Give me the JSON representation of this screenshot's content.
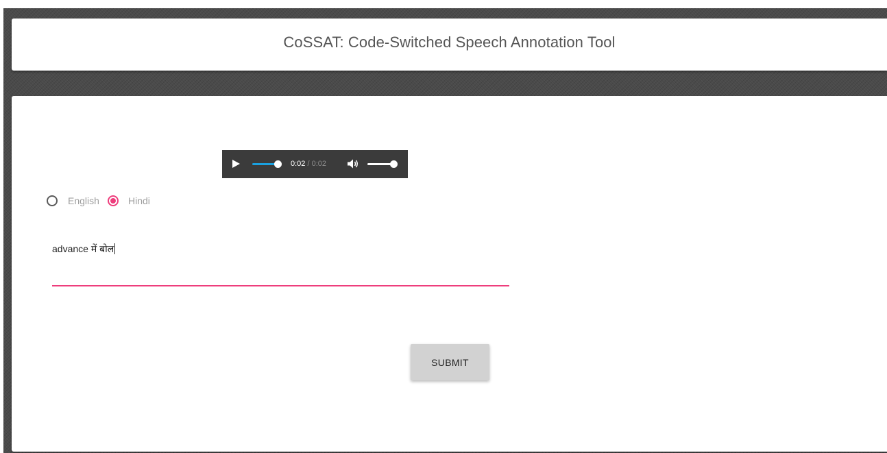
{
  "header": {
    "title": "CoSSAT: Code-Switched Speech Annotation Tool"
  },
  "audio_player": {
    "current_time": "0:02",
    "separator": " / ",
    "duration": "0:02",
    "playback_progress": 1.0,
    "volume_level": 1.0,
    "play_icon": "play-icon",
    "volume_icon": "volume-icon"
  },
  "language_options": {
    "options": [
      {
        "label": "English",
        "selected": false
      },
      {
        "label": "Hindi",
        "selected": true
      }
    ]
  },
  "transcript": {
    "value": "advance में बोल"
  },
  "submit": {
    "label": "SUBMIT"
  },
  "colors": {
    "accent": "#ee3d7c",
    "seek_fill": "#1aa1e0",
    "player_bg": "#3b3b3b",
    "page_backdrop": "#4a4a4a"
  }
}
